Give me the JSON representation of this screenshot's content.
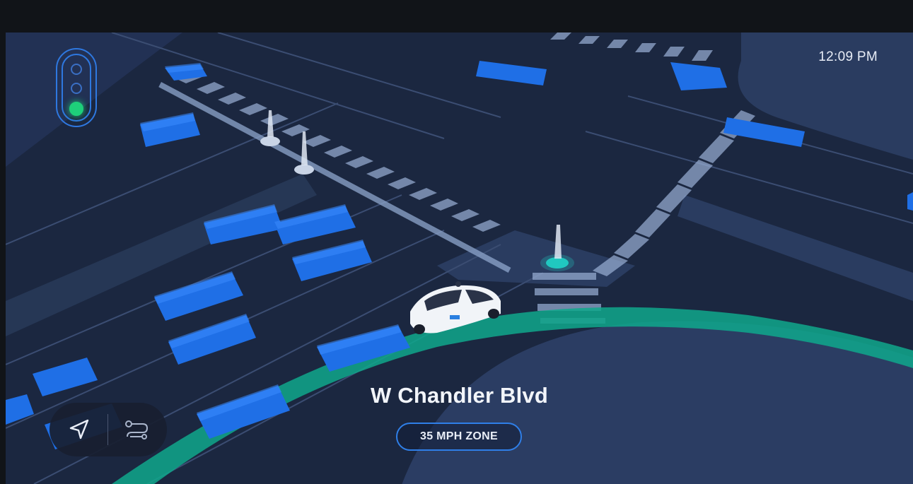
{
  "status_bar": {
    "time": "12:09 PM"
  },
  "traffic_signal": {
    "active_light": "green",
    "colors": {
      "green": "#1ecf7a",
      "frame": "#2e78e0"
    }
  },
  "location": {
    "street_name": "W Chandler Blvd",
    "speed_zone": "35 MPH ZONE"
  },
  "controls": {
    "buttons": [
      "navigation-arrow-icon",
      "route-options-icon"
    ]
  },
  "map": {
    "route_color": "#0fa88c",
    "vehicle_color": "#1f6fe6",
    "road_color": "#1b2740"
  }
}
